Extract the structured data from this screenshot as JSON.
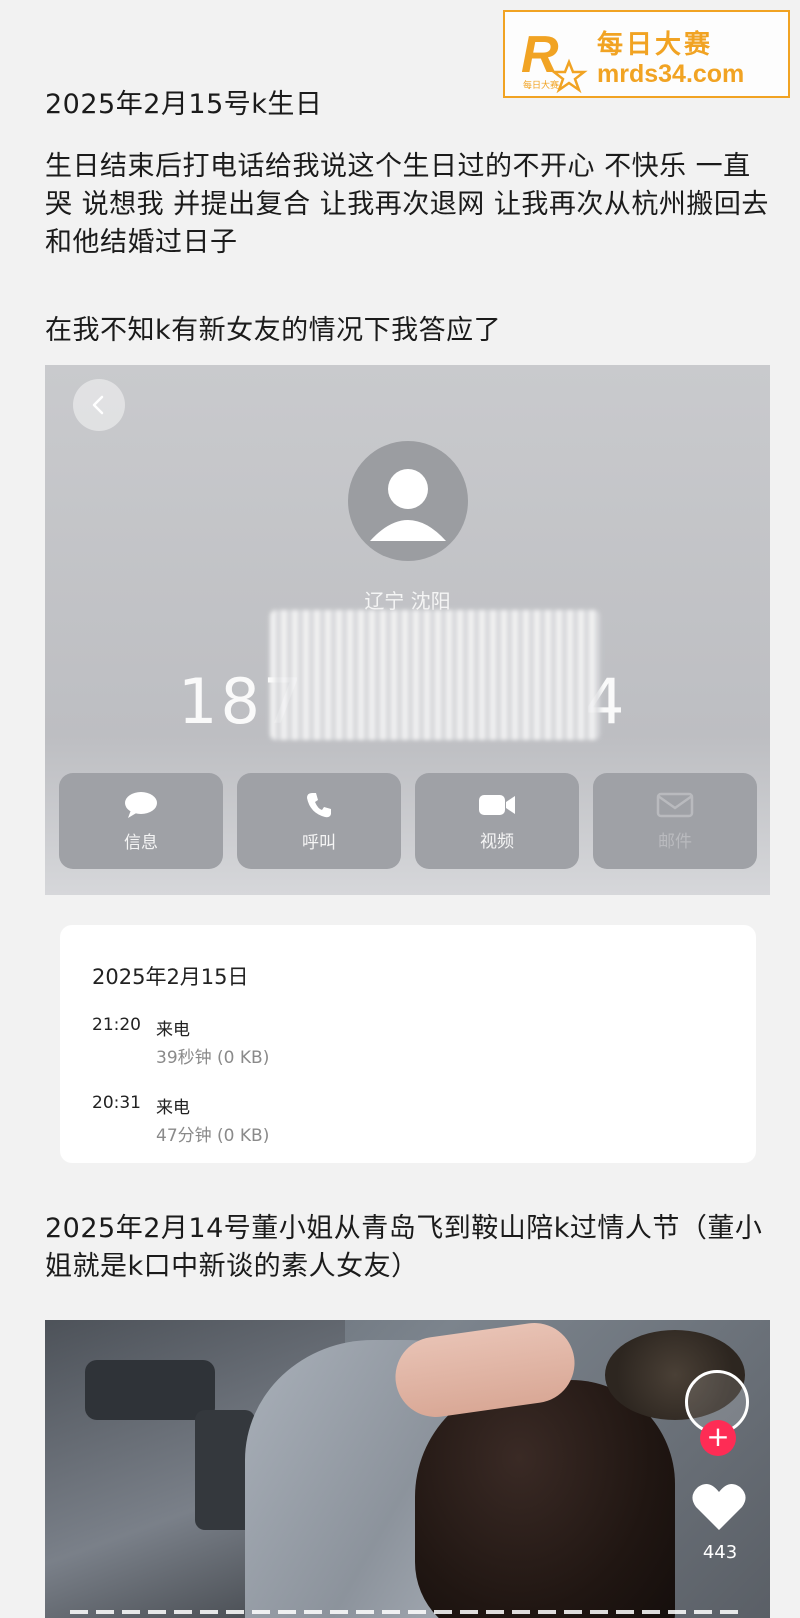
{
  "watermark": {
    "title": "每日大赛",
    "url": "mrds34.com",
    "logo_letter": "R",
    "logo_small": "每日大赛",
    "accent": "#f1a323"
  },
  "post": {
    "heading1": "2025年2月15号k生日",
    "para1": "生日结束后打电话给我说这个生日过的不开心 不快乐 一直哭 说想我 并提出复合 让我再次退网 让我再次从杭州搬回去 和他结婚过日子",
    "para2": "在我不知k有新女友的情况下我答应了",
    "heading2": "2025年2月14号董小姐从青岛飞到鞍山陪k过情人节（董小姐就是k口中新谈的素人女友）"
  },
  "contact": {
    "region": "辽宁 沈阳",
    "number_visible_start": "187",
    "number_visible_end": "4",
    "actions": [
      {
        "label": "信息",
        "icon": "message-icon"
      },
      {
        "label": "呼叫",
        "icon": "phone-icon"
      },
      {
        "label": "视频",
        "icon": "video-icon"
      },
      {
        "label": "邮件",
        "icon": "mail-icon"
      }
    ]
  },
  "call_log": {
    "date": "2025年2月15日",
    "entries": [
      {
        "time": "21:20",
        "type": "来电",
        "duration": "39秒钟 (0 KB)"
      },
      {
        "time": "20:31",
        "type": "来电",
        "duration": "47分钟 (0 KB)"
      }
    ]
  },
  "video": {
    "like_count": "443",
    "plus_color": "#fe2c55"
  }
}
